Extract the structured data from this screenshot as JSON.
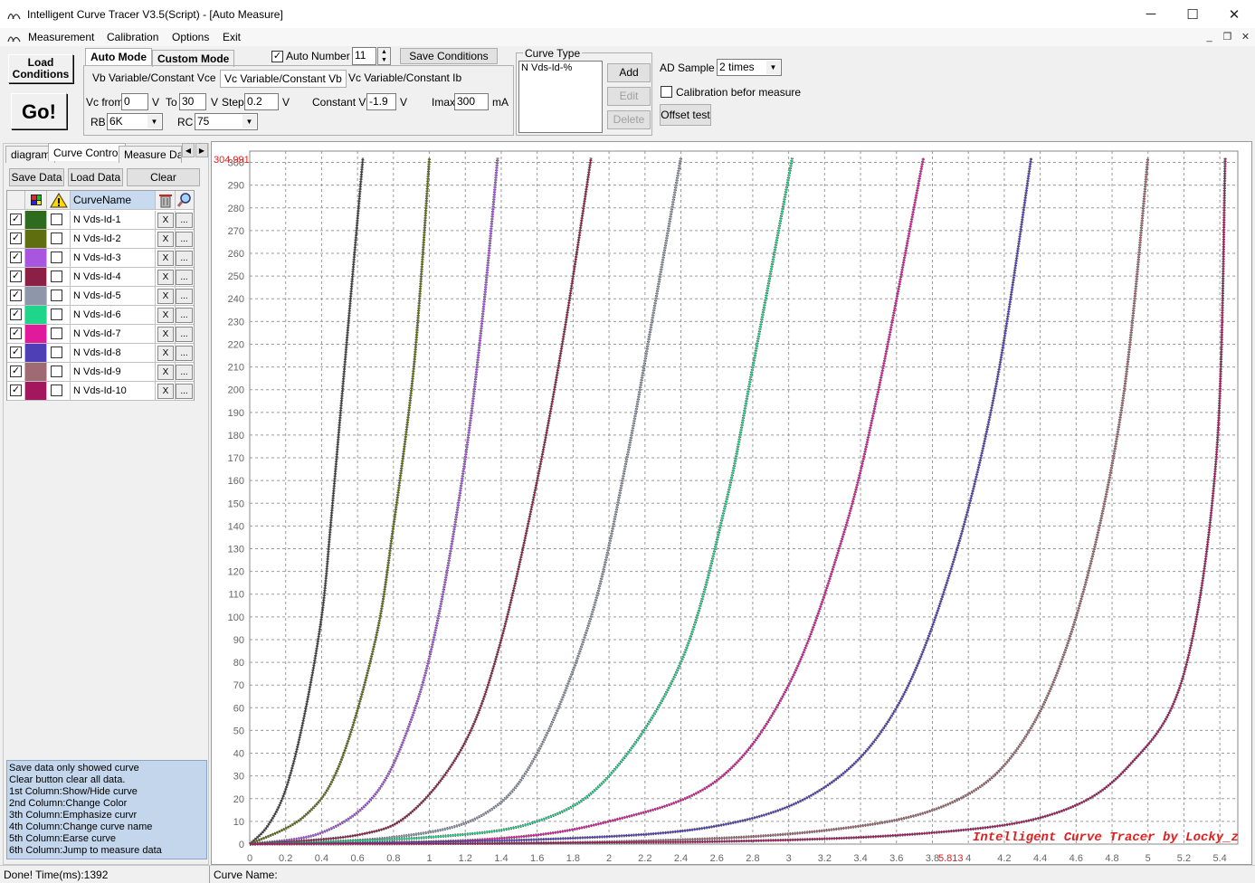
{
  "window": {
    "title": "Intelligent Curve Tracer V3.5(Script) - [Auto Measure]",
    "app_icon": "curve-app-icon",
    "minimize": "─",
    "maximize": "☐",
    "close": "✕"
  },
  "menu": {
    "items": [
      "Measurement",
      "Calibration",
      "Options",
      "Exit"
    ],
    "mdi_minimize": "_",
    "mdi_restore": "❐",
    "mdi_close": "✕"
  },
  "toolbar": {
    "load_conditions": "Load Conditions",
    "go": "Go!",
    "mode_tabs": [
      "Auto Mode",
      "Custom Mode"
    ],
    "sub_tabs": [
      "Vb Variable/Constant Vce",
      "Vc Variable/Constant Vb",
      "Vc Variable/Constant Ib"
    ],
    "auto_number_label": "Auto Number",
    "auto_number_checked": true,
    "auto_number_value": "11",
    "save_conditions": "Save Conditions",
    "vc_from_label": "Vc from",
    "vc_from": "0",
    "v1": "V",
    "to_label": "To",
    "to_value": "30",
    "v2": "V",
    "step_label": "Step",
    "step_value": "0.2",
    "v3": "V",
    "constant_vb_label": "Constant Vb",
    "constant_vb": "-1.9",
    "v4": "V",
    "imax_label": "Imax",
    "imax": "300",
    "ma": "mA",
    "rb_label": "RB",
    "rb_value": "6K",
    "rc_label": "RC",
    "rc_value": "75"
  },
  "curve_type": {
    "legend": "Curve Type",
    "entry": "N Vds-Id-%",
    "add": "Add",
    "edit": "Edit",
    "delete": "Delete"
  },
  "ad": {
    "ad_sample_label": "AD Sample",
    "ad_sample_value": "2 times",
    "calib_label": "Calibration befor measure",
    "calib_checked": false,
    "offset_test": "Offset test"
  },
  "left_panel": {
    "tabs": [
      "diagram",
      "Curve Control",
      "Measure Data"
    ],
    "save_data": "Save Data",
    "load_data": "Load Data",
    "clear": "Clear",
    "grid_header": "CurveName",
    "x_label": "X",
    "more_label": "...",
    "curves": [
      {
        "name": "N Vds-Id-1",
        "color": "#2e6b1f",
        "shown": true
      },
      {
        "name": "N Vds-Id-2",
        "color": "#5f6e0e",
        "shown": true
      },
      {
        "name": "N Vds-Id-3",
        "color": "#a855e0",
        "shown": true
      },
      {
        "name": "N Vds-Id-4",
        "color": "#8c1f45",
        "shown": true
      },
      {
        "name": "N Vds-Id-5",
        "color": "#8e96aa",
        "shown": true
      },
      {
        "name": "N Vds-Id-6",
        "color": "#1ed58a",
        "shown": true
      },
      {
        "name": "N Vds-Id-7",
        "color": "#e01a9a",
        "shown": true
      },
      {
        "name": "N Vds-Id-8",
        "color": "#4f3fb6",
        "shown": true
      },
      {
        "name": "N Vds-Id-9",
        "color": "#a06a72",
        "shown": true
      },
      {
        "name": "N Vds-Id-10",
        "color": "#a3175e",
        "shown": true
      }
    ],
    "help_lines": [
      "  Save data only showed curve",
      "  Clear button clear all data.",
      "1st Column:Show/Hide curve",
      "2nd Column:Change Color",
      "3th Column:Emphasize curvr",
      "4th Column:Change curve name",
      "5th Column:Earse curve",
      "6th Column:Jump to measure data"
    ]
  },
  "status": {
    "left": "Done!  Time(ms):1392",
    "curve_name_label": "Curve Name:"
  },
  "chart_data": {
    "type": "line",
    "y_max_label": "304.991",
    "x_max_label": "5.813",
    "watermark": "Intelligent Curve Tracer by Locky_z",
    "xlim": [
      0,
      5.5
    ],
    "ylim": [
      0,
      305
    ],
    "x_ticks": [
      "0",
      "0.2",
      "0.4",
      "0.6",
      "0.8",
      "1",
      "1.2",
      "1.4",
      "1.6",
      "1.8",
      "2",
      "2.2",
      "2.4",
      "2.6",
      "2.8",
      "3",
      "3.2",
      "3.4",
      "3.6",
      "3.8",
      "4",
      "4.2",
      "4.4",
      "4.6",
      "4.8",
      "5",
      "5.2",
      "5.4"
    ],
    "y_ticks": [
      "0",
      "10",
      "20",
      "30",
      "40",
      "50",
      "60",
      "70",
      "80",
      "90",
      "100",
      "110",
      "120",
      "130",
      "140",
      "150",
      "160",
      "170",
      "180",
      "190",
      "200",
      "210",
      "220",
      "230",
      "240",
      "250",
      "260",
      "270",
      "280",
      "290",
      "300"
    ],
    "grid": true,
    "series": [
      {
        "color": "#3d3d3d",
        "x": [
          0,
          0.1,
          0.2,
          0.3,
          0.4,
          0.45,
          0.5,
          0.55,
          0.6,
          0.63
        ],
        "y": [
          0,
          8,
          24,
          55,
          100,
          140,
          185,
          230,
          275,
          302
        ]
      },
      {
        "color": "#5f6e0e",
        "x": [
          0,
          0.3,
          0.5,
          0.7,
          0.8,
          0.9,
          0.95,
          1.0
        ],
        "y": [
          0,
          12,
          35,
          90,
          140,
          200,
          245,
          302
        ]
      },
      {
        "color": "#a855e0",
        "x": [
          0,
          0.4,
          0.7,
          0.9,
          1.05,
          1.2,
          1.3,
          1.38
        ],
        "y": [
          0,
          5,
          22,
          55,
          100,
          170,
          235,
          302
        ]
      },
      {
        "color": "#8c1f45",
        "x": [
          0,
          0.6,
          0.9,
          1.2,
          1.4,
          1.6,
          1.75,
          1.9
        ],
        "y": [
          0,
          4,
          14,
          45,
          90,
          160,
          225,
          302
        ]
      },
      {
        "color": "#8e96aa",
        "x": [
          0,
          0.8,
          1.3,
          1.6,
          1.9,
          2.1,
          2.25,
          2.4
        ],
        "y": [
          0,
          3,
          13,
          40,
          100,
          170,
          235,
          302
        ]
      },
      {
        "color": "#1ed58a",
        "x": [
          0,
          1.0,
          1.6,
          2.0,
          2.4,
          2.65,
          2.8,
          3.02
        ],
        "y": [
          0,
          3,
          10,
          30,
          80,
          150,
          210,
          302
        ]
      },
      {
        "color": "#e01a9a",
        "x": [
          0,
          1.3,
          2.0,
          2.6,
          3.0,
          3.3,
          3.5,
          3.75
        ],
        "y": [
          0,
          2,
          10,
          28,
          70,
          135,
          200,
          302
        ]
      },
      {
        "color": "#4f3fb6",
        "x": [
          0,
          1.6,
          2.6,
          3.2,
          3.6,
          3.9,
          4.15,
          4.35
        ],
        "y": [
          0,
          2,
          8,
          25,
          60,
          120,
          200,
          302
        ]
      },
      {
        "color": "#a06a72",
        "x": [
          0,
          2.0,
          3.2,
          3.9,
          4.3,
          4.6,
          4.85,
          5.0
        ],
        "y": [
          0,
          1,
          6,
          18,
          45,
          100,
          190,
          302
        ]
      },
      {
        "color": "#a3175e",
        "x": [
          0,
          2.5,
          3.8,
          4.5,
          4.9,
          5.2,
          5.38,
          5.43
        ],
        "y": [
          0,
          1,
          5,
          14,
          35,
          75,
          170,
          302
        ]
      }
    ]
  }
}
